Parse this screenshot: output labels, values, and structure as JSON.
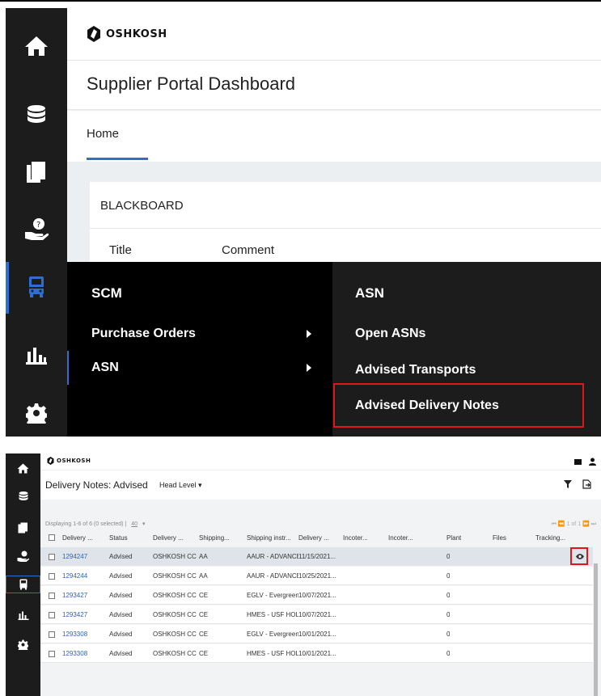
{
  "brand": {
    "logo_text": "OSHKOSH"
  },
  "portal": {
    "title": "Supplier Portal Dashboard",
    "tab_home": "Home",
    "blackboard": {
      "title": "BLACKBOARD",
      "col_title": "Title",
      "col_comment": "Comment"
    }
  },
  "menu": {
    "scm_header": "SCM",
    "scm_items": [
      "Purchase Orders",
      "ASN"
    ],
    "asn_header": "ASN",
    "asn_items": [
      "Open ASNs",
      "Advised Transports",
      "Advised Delivery Notes"
    ]
  },
  "rail_icons": [
    "home-icon",
    "database-icon",
    "documents-icon",
    "support-hand-icon",
    "truck-icon",
    "bar-chart-icon",
    "gear-icon"
  ],
  "delivery_notes": {
    "title": "Delivery Notes: Advised",
    "level_selector": "Head Level ▾",
    "displaying": "Displaying 1-6 of 6 (0 selected) |",
    "page_size": "40",
    "pagination": "⏮ ⏪ 1 of 1 ⏩ ⏭",
    "columns": [
      "Delivery ...",
      "Status",
      "Delivery ...",
      "Shipping...",
      "Shipping instr...",
      "Delivery ...",
      "Incoter...",
      "Incoter...",
      "Plant",
      "Files",
      "Tracking..."
    ],
    "rows": [
      {
        "id": "1294247",
        "status": "Advised",
        "delivery": "OSHKOSH CC",
        "shipping": "AA",
        "instr": "AAUR - ADVANCEI",
        "date": "11/15/2021...",
        "plant": "0"
      },
      {
        "id": "1294244",
        "status": "Advised",
        "delivery": "OSHKOSH CC",
        "shipping": "AA",
        "instr": "AAUR - ADVANCEI",
        "date": "10/25/2021...",
        "plant": "0"
      },
      {
        "id": "1293427",
        "status": "Advised",
        "delivery": "OSHKOSH CC",
        "shipping": "CE",
        "instr": "EGLV - Evergreen...",
        "date": "10/07/2021...",
        "plant": "0"
      },
      {
        "id": "1293427",
        "status": "Advised",
        "delivery": "OSHKOSH CC",
        "shipping": "CE",
        "instr": "HMES - USF HOLL",
        "date": "10/07/2021...",
        "plant": "0"
      },
      {
        "id": "1293308",
        "status": "Advised",
        "delivery": "OSHKOSH CC",
        "shipping": "CE",
        "instr": "EGLV - Evergreen...",
        "date": "10/01/2021...",
        "plant": "0"
      },
      {
        "id": "1293308",
        "status": "Advised",
        "delivery": "OSHKOSH CC",
        "shipping": "CE",
        "instr": "HMES - USF HOLL",
        "date": "10/01/2021...",
        "plant": "0"
      }
    ]
  },
  "colors": {
    "accent_blue": "#2d6fd1",
    "highlight_red": "#e0161a",
    "rail_dark": "#1c1c1c",
    "link": "#2f62b5"
  }
}
